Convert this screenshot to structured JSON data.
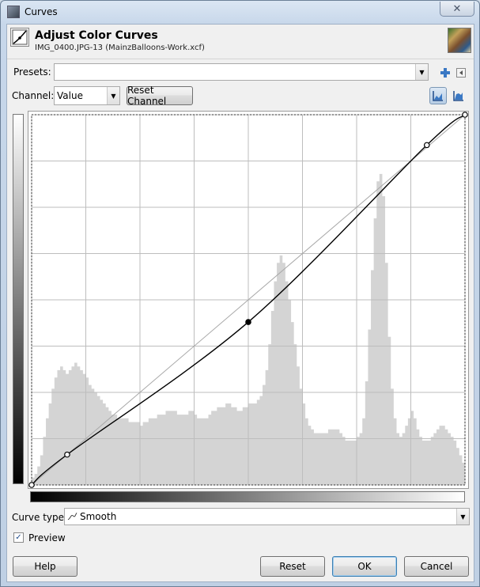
{
  "window": {
    "title": "Curves",
    "close_glyph": "✕"
  },
  "header": {
    "title": "Adjust Color Curves",
    "subtitle": "IMG_0400.JPG-13 (MainzBalloons-Work.xcf)"
  },
  "presets": {
    "label": "Presets:",
    "value": ""
  },
  "channel": {
    "label": "Channel:",
    "value": "Value",
    "reset_label": "Reset Channel"
  },
  "histogram_scale": {
    "linear_icon": "linear-histogram-icon",
    "log_icon": "log-histogram-icon",
    "selected": "linear"
  },
  "curve": {
    "points": [
      [
        0,
        0
      ],
      [
        0.082,
        0.082
      ],
      [
        0.5,
        0.44
      ],
      [
        0.912,
        0.918
      ],
      [
        1,
        1
      ]
    ],
    "selected_point_index": 2,
    "histogram": [
      2,
      3,
      5,
      8,
      13,
      18,
      22,
      26,
      29,
      31,
      32,
      31,
      30,
      31,
      32,
      33,
      32,
      31,
      30,
      29,
      27,
      26,
      25,
      24,
      23,
      22,
      21,
      20,
      19,
      19,
      18,
      18,
      18,
      18,
      17,
      17,
      17,
      17,
      16,
      17,
      17,
      18,
      18,
      18,
      19,
      19,
      19,
      20,
      20,
      20,
      20,
      19,
      19,
      19,
      19,
      20,
      20,
      19,
      18,
      18,
      18,
      18,
      19,
      20,
      20,
      21,
      21,
      21,
      22,
      22,
      21,
      21,
      20,
      20,
      21,
      21,
      22,
      22,
      22,
      23,
      24,
      27,
      31,
      38,
      47,
      55,
      60,
      62,
      60,
      55,
      50,
      44,
      38,
      32,
      26,
      22,
      18,
      16,
      15,
      14,
      14,
      14,
      14,
      14,
      15,
      15,
      15,
      15,
      14,
      13,
      12,
      12,
      12,
      12,
      13,
      14,
      18,
      28,
      42,
      58,
      72,
      82,
      84,
      78,
      60,
      40,
      26,
      18,
      14,
      13,
      14,
      16,
      18,
      20,
      18,
      15,
      13,
      12,
      12,
      12,
      13,
      14,
      15,
      16,
      16,
      15,
      14,
      13,
      12,
      10,
      8,
      6
    ]
  },
  "curve_type": {
    "label": "Curve type:",
    "value": "Smooth"
  },
  "preview": {
    "label": "Preview",
    "checked": true
  },
  "buttons": {
    "help": "Help",
    "reset": "Reset",
    "ok": "OK",
    "cancel": "Cancel"
  }
}
